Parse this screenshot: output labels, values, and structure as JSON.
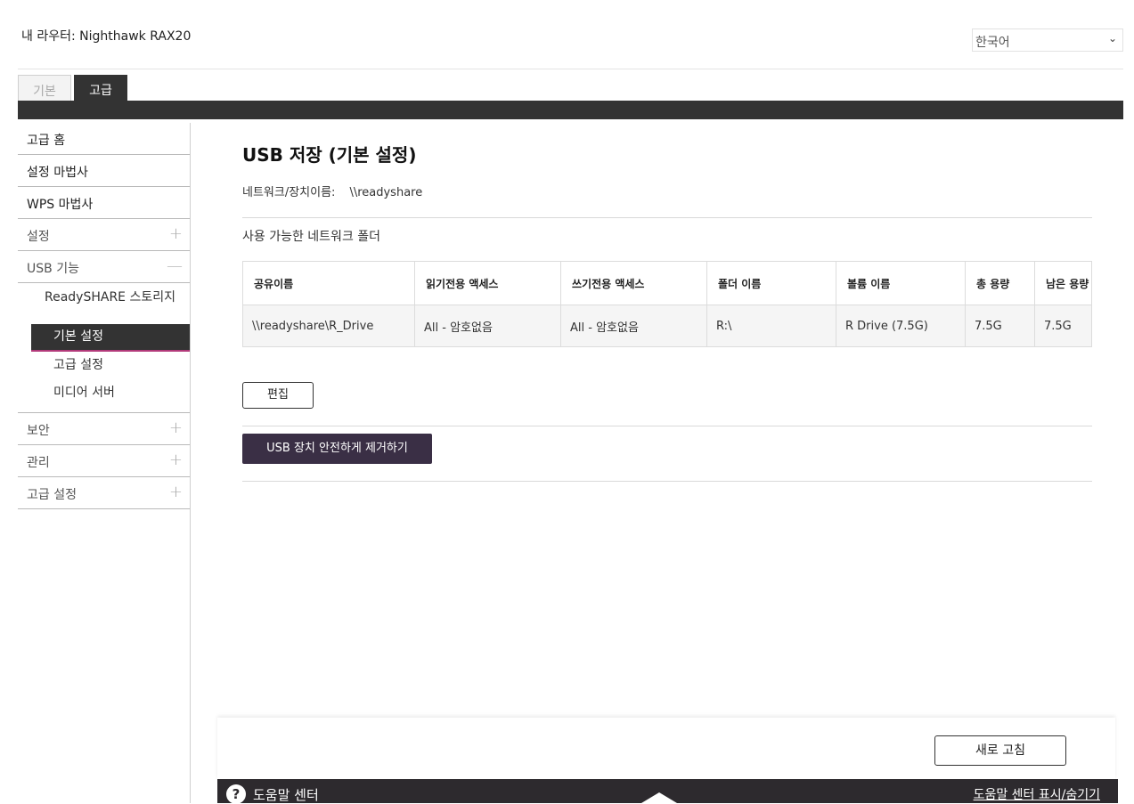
{
  "header": {
    "router_title": "내 라우터: Nighthawk RAX20",
    "language": "한국어"
  },
  "tabs": {
    "basic": "기본",
    "advanced": "고급"
  },
  "sidebar": {
    "items": [
      {
        "label": "고급 홈"
      },
      {
        "label": "설정 마법사"
      },
      {
        "label": "WPS 마법사"
      },
      {
        "label": "설정",
        "sign": "+"
      },
      {
        "label": "USB 기능",
        "sign": "—"
      },
      {
        "label": "보안",
        "sign": "+"
      },
      {
        "label": "관리",
        "sign": "+"
      },
      {
        "label": "고급 설정",
        "sign": "+"
      }
    ],
    "usb_sub": {
      "readyshare": "ReadySHARE 스토리지",
      "basic_settings": "기본 설정",
      "advanced_settings": "고급 설정",
      "media_server": "미디어 서버"
    }
  },
  "main": {
    "title": "USB 저장 (기본 설정)",
    "network_name_label": "네트워크/장치이름:",
    "network_name_value": "\\\\readyshare",
    "folders_label": "사용 가능한 네트워크 폴더",
    "table": {
      "headers": [
        "공유이름",
        "읽기전용 액세스",
        "쓰기전용 액세스",
        "폴더 이름",
        "볼륨 이름",
        "총 용량",
        "남은 용량"
      ],
      "rows": [
        [
          "\\\\readyshare\\R_Drive",
          "All - 암호없음",
          "All - 암호없음",
          "R:\\",
          "R Drive (7.5G)",
          "7.5G",
          "7.5G"
        ]
      ]
    },
    "edit_button": "편집",
    "remove_button": "USB 장치 안전하게 제거하기"
  },
  "footer": {
    "refresh_button": "새로 고침",
    "help_label": "도움말 센터",
    "help_toggle": "도움말 센터 표시/숨기기",
    "help_icon_glyph": "?"
  }
}
